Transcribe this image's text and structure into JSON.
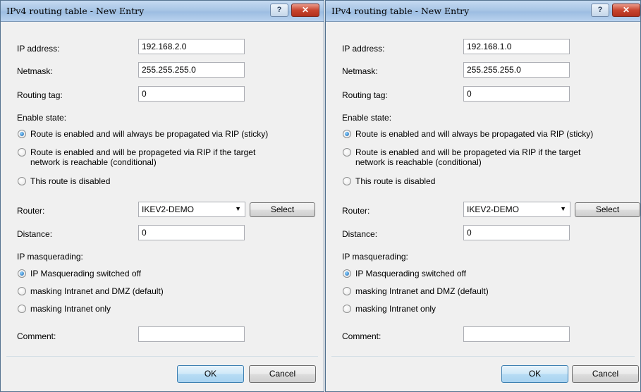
{
  "dialogs": [
    {
      "title": "IPv4 routing table - New Entry",
      "help_glyph": "?",
      "close_glyph": "✕",
      "ip_address": {
        "label": "IP address:",
        "value": "192.168.2.0"
      },
      "netmask": {
        "label": "Netmask:",
        "value": "255.255.255.0"
      },
      "routing_tag": {
        "label": "Routing tag:",
        "value": "0"
      },
      "enable_state": {
        "label": "Enable state:",
        "options": [
          {
            "line1": "Route is enabled and will always be propagated via RIP (sticky)",
            "line2": "",
            "checked": true
          },
          {
            "line1": "Route is enabled and will be propageted via RIP if the target",
            "line2": "network is reachable (conditional)",
            "checked": false
          },
          {
            "line1": "This route is disabled",
            "line2": "",
            "checked": false
          }
        ]
      },
      "router": {
        "label": "Router:",
        "value": "IKEV2-DEMO",
        "select_label": "Select"
      },
      "distance": {
        "label": "Distance:",
        "value": "0"
      },
      "ip_masquerading": {
        "label": "IP masquerading:",
        "options": [
          {
            "text": "IP Masquerading switched off",
            "checked": true
          },
          {
            "text": "masking Intranet and DMZ (default)",
            "checked": false
          },
          {
            "text": "masking Intranet only",
            "checked": false
          }
        ]
      },
      "comment": {
        "label": "Comment:",
        "value": ""
      },
      "buttons": {
        "ok": "OK",
        "cancel": "Cancel"
      }
    },
    {
      "title": "IPv4 routing table - New Entry",
      "help_glyph": "?",
      "close_glyph": "✕",
      "ip_address": {
        "label": "IP address:",
        "value": "192.168.1.0"
      },
      "netmask": {
        "label": "Netmask:",
        "value": "255.255.255.0"
      },
      "routing_tag": {
        "label": "Routing tag:",
        "value": "0"
      },
      "enable_state": {
        "label": "Enable state:",
        "options": [
          {
            "line1": "Route is enabled and will always be propagated via RIP (sticky)",
            "line2": "",
            "checked": true
          },
          {
            "line1": "Route is enabled and will be propageted via RIP if the target",
            "line2": "network is reachable (conditional)",
            "checked": false
          },
          {
            "line1": "This route is disabled",
            "line2": "",
            "checked": false
          }
        ]
      },
      "router": {
        "label": "Router:",
        "value": "IKEV2-DEMO",
        "select_label": "Select"
      },
      "distance": {
        "label": "Distance:",
        "value": "0"
      },
      "ip_masquerading": {
        "label": "IP masquerading:",
        "options": [
          {
            "text": "IP Masquerading switched off",
            "checked": true
          },
          {
            "text": "masking Intranet and DMZ (default)",
            "checked": false
          },
          {
            "text": "masking Intranet only",
            "checked": false
          }
        ]
      },
      "comment": {
        "label": "Comment:",
        "value": ""
      },
      "buttons": {
        "ok": "OK",
        "cancel": "Cancel"
      }
    }
  ]
}
